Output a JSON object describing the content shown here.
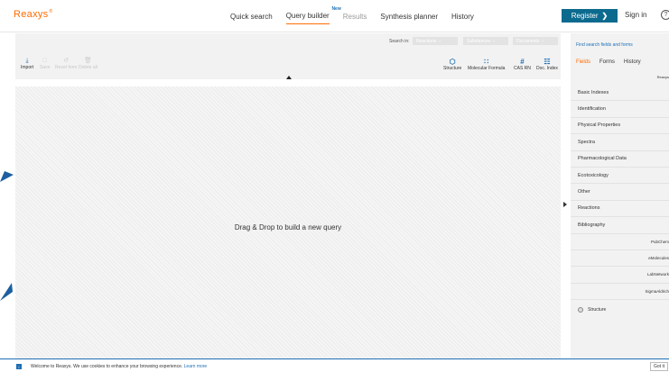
{
  "brand": {
    "logo": "Reaxys",
    "tm": "®"
  },
  "nav": {
    "items": [
      {
        "label": "Quick search"
      },
      {
        "label": "Query builder",
        "badge": "New"
      },
      {
        "label": "Results"
      },
      {
        "label": "Synthesis planner"
      },
      {
        "label": "History"
      }
    ],
    "register": "Register",
    "signin": "Sign in",
    "help": "?"
  },
  "toolbar": {
    "search_in": "Search in:",
    "scopes": [
      "Reactions",
      "Substances",
      "Documents"
    ],
    "left_tools": [
      {
        "label": "Import",
        "icon": "import-icon",
        "enabled": true
      },
      {
        "label": "Save",
        "icon": "save-icon",
        "enabled": false
      },
      {
        "label": "Reset form",
        "icon": "reset-icon",
        "enabled": false
      },
      {
        "label": "Delete all",
        "icon": "delete-icon",
        "enabled": false
      }
    ],
    "right_tools": [
      {
        "label": "Structure",
        "icon": "structure-icon"
      },
      {
        "label": "Molecular Formula",
        "icon": "molecular-formula-icon"
      },
      {
        "label": "CAS RN",
        "icon": "hash-icon"
      },
      {
        "label": "Doc. Index",
        "icon": "doc-index-icon"
      }
    ]
  },
  "canvas": {
    "drop_text": "Drag & Drop to build a new query"
  },
  "right_panel": {
    "find_link": "Find search fields and forms",
    "tabs": [
      "Fields",
      "Forms",
      "History"
    ],
    "active_tab": "Fields",
    "source_label": "Reaxys",
    "items": [
      "Basic Indexes",
      "Identification",
      "Physical Properties",
      "Spectra",
      "Pharmacological Data",
      "Ecotoxicology",
      "Other",
      "Reactions",
      "Bibliography"
    ],
    "sources": [
      "PubChem",
      "eMolecules",
      "LabNetwork",
      "SigmaAldrich"
    ],
    "structure_item": "Structure"
  },
  "cookie": {
    "text": "Welcome to Reaxys. We use cookies to enhance your browsing experience.",
    "learn_more": "Learn more",
    "button": "Got it"
  },
  "colors": {
    "accent": "#ff6c00",
    "primary": "#0b6a8e",
    "link": "#1d6fb4"
  }
}
